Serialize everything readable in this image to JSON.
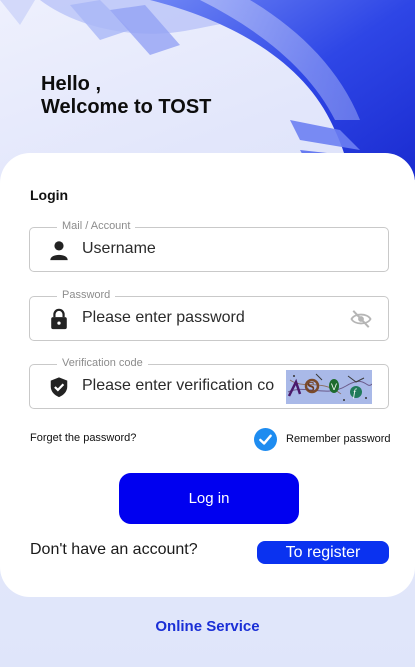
{
  "header": {
    "greeting_line1": "Hello ,",
    "greeting_line2": "Welcome to TOST"
  },
  "form": {
    "title": "Login",
    "account": {
      "legend": "Mail / Account",
      "placeholder": "Username"
    },
    "password": {
      "legend": "Password",
      "placeholder": "Please enter password"
    },
    "verification": {
      "legend": "Verification code",
      "placeholder": "Please enter verification co"
    },
    "forgot_label": "Forget the password?",
    "remember_label": "Remember password",
    "login_label": "Log in",
    "no_account_text": "Don't have an account?",
    "register_label": "To register"
  },
  "footer": {
    "online_service": "Online Service"
  },
  "colors": {
    "primary": "#0000f0",
    "register": "#0a32f0",
    "check": "#1e8cf0",
    "service_link": "#1a2fd6"
  },
  "icons": {
    "account": "person-icon",
    "password": "lock-icon",
    "toggle": "eye-off-icon",
    "verification": "shield-check-icon",
    "remember": "checkmark-icon"
  }
}
